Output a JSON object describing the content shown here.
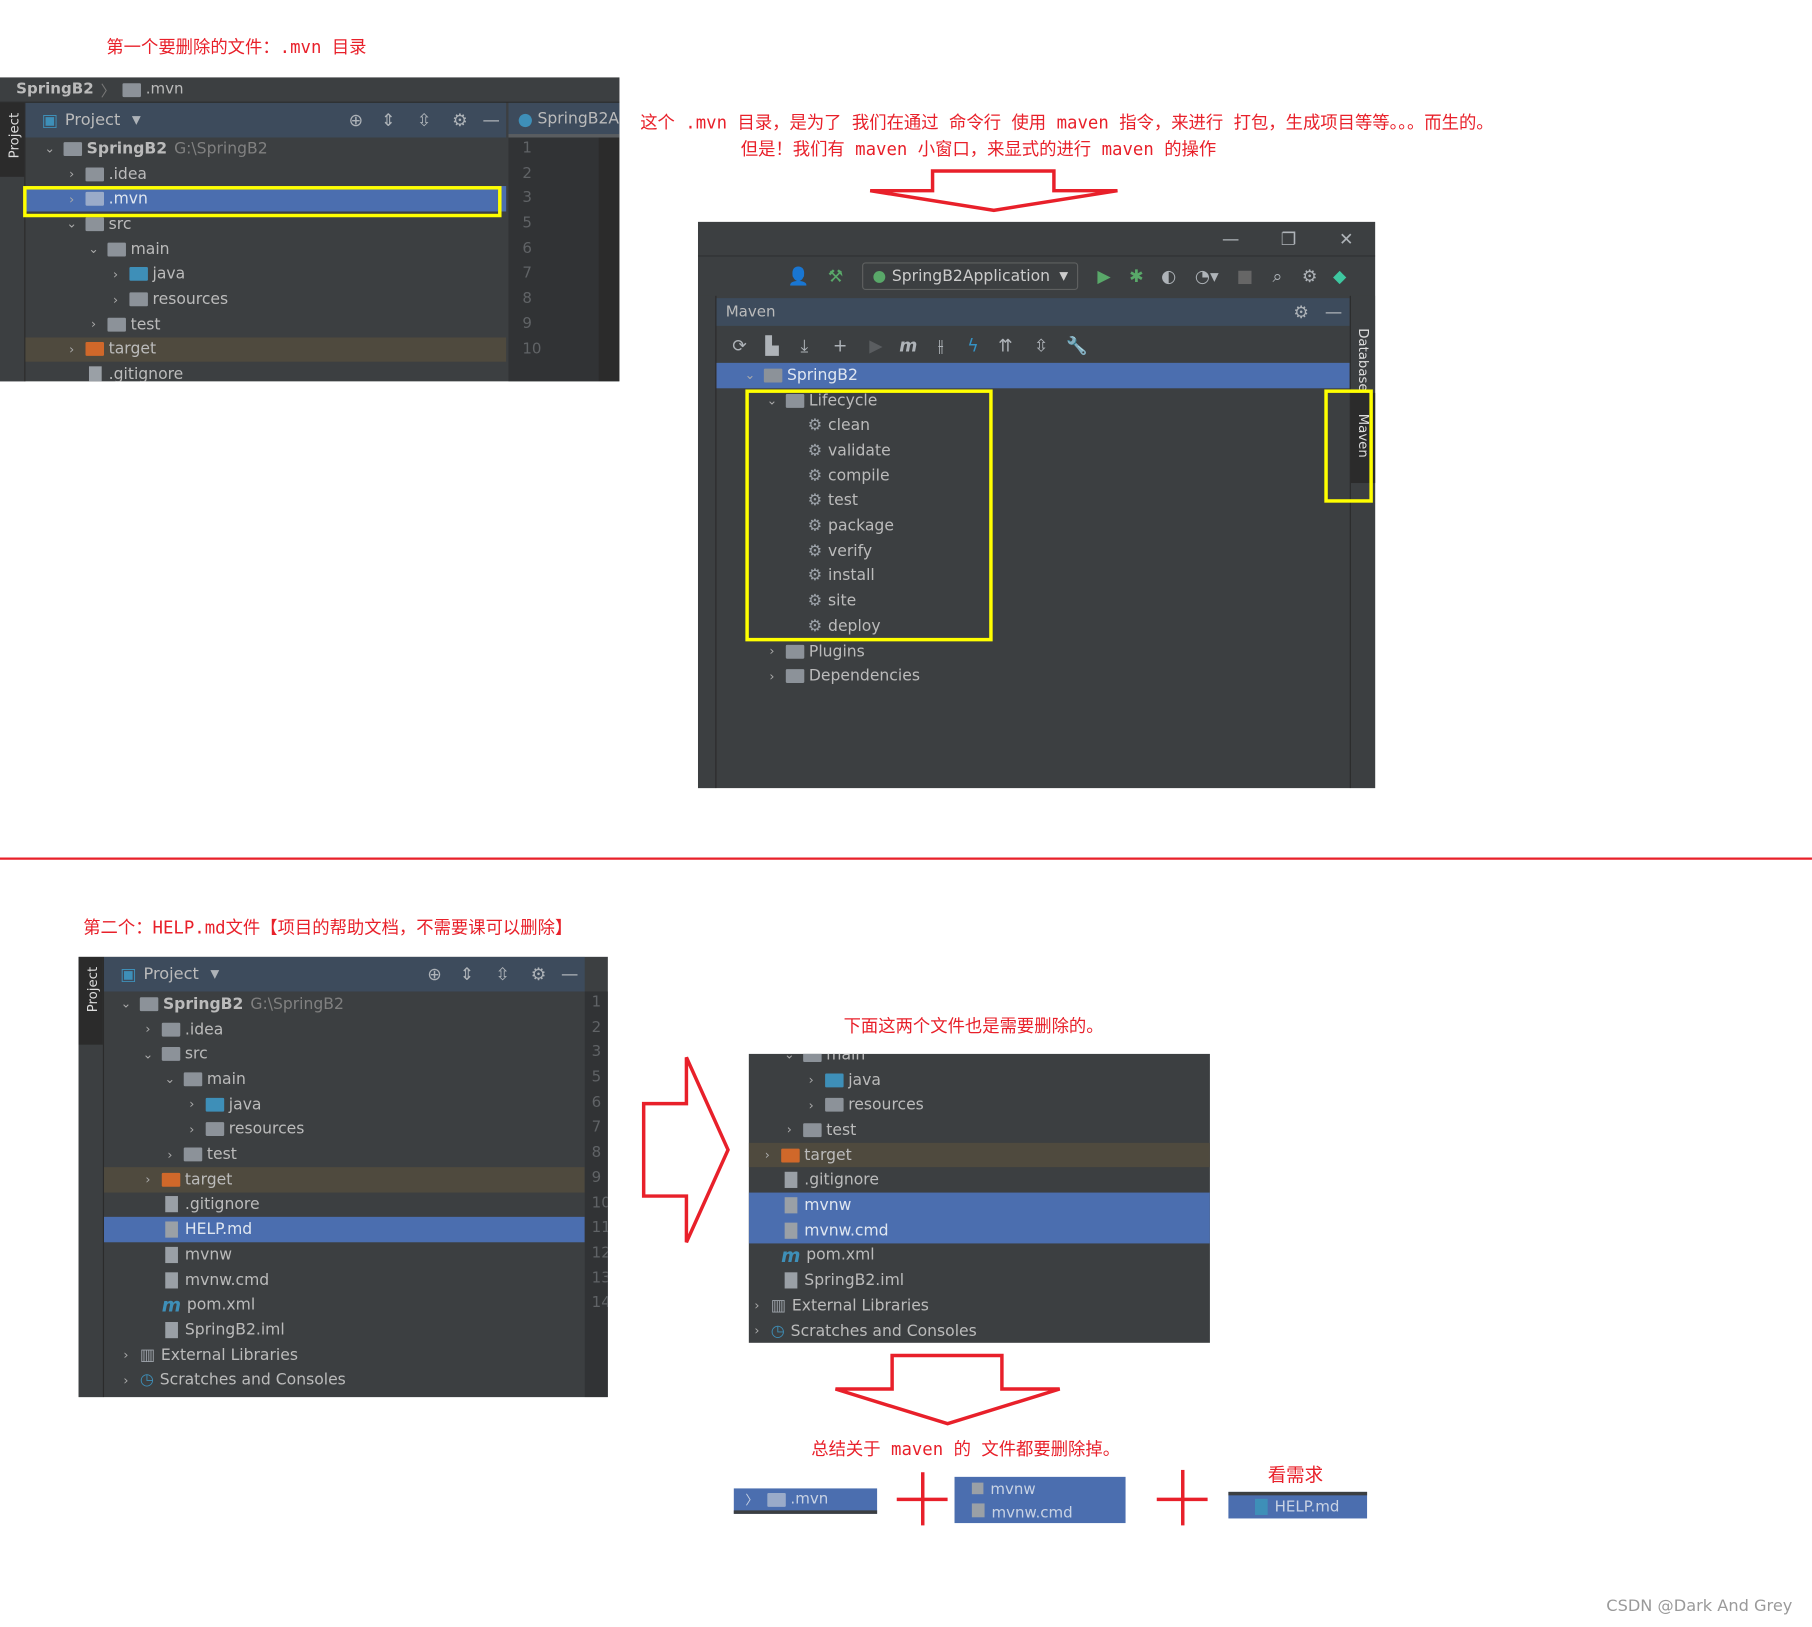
{
  "notes": {
    "first": "第一个要删除的文件：.mvn 目录",
    "explain_line1": "这个 .mvn 目录，是为了 我们在通过 命令行 使用 maven 指令，来进行 打包，生成项目等等。。。而生的。",
    "explain_line2": "但是！我们有 maven 小窗口，来显式的进行 maven 的操作",
    "second": "第二个：HELP.md文件【项目的帮助文档，不需要课可以删除】",
    "also_delete": "下面这两个文件也是需要删除的。",
    "summary": "总结关于 maven 的 文件都要删除掉。",
    "as_needed": "看需求",
    "watermark": "CSDN @Dark And Grey"
  },
  "colors": {
    "annotation": "#e8202a",
    "highlight_box": "#ffff00",
    "selection": "#4b6eaf",
    "ide_bg": "#3c3f41"
  },
  "panel_a": {
    "breadcrumb": [
      "SpringB2",
      ".mvn"
    ],
    "side_tab": "Project",
    "header": "Project",
    "editor_tab": "SpringB2A",
    "line_numbers": [
      "1",
      "2",
      "3",
      "5",
      "6",
      "7",
      "8",
      "9",
      "10"
    ],
    "tree": [
      {
        "label": "SpringB2",
        "extra": "G:\\SpringB2",
        "depth": 0,
        "chev": "v",
        "icon": "module",
        "bold": true
      },
      {
        "label": ".idea",
        "depth": 1,
        "chev": ">",
        "icon": "folder"
      },
      {
        "label": ".mvn",
        "depth": 1,
        "chev": ">",
        "icon": "folder",
        "sel": true
      },
      {
        "label": "src",
        "depth": 1,
        "chev": "v",
        "icon": "folder"
      },
      {
        "label": "main",
        "depth": 2,
        "chev": "v",
        "icon": "folder"
      },
      {
        "label": "java",
        "depth": 3,
        "chev": ">",
        "icon": "folder-blue"
      },
      {
        "label": "resources",
        "depth": 3,
        "chev": ">",
        "icon": "folder"
      },
      {
        "label": "test",
        "depth": 2,
        "chev": ">",
        "icon": "folder"
      },
      {
        "label": "target",
        "depth": 1,
        "chev": ">",
        "icon": "folder-orange",
        "hl": true
      },
      {
        "label": ".gitignore",
        "depth": 1,
        "chev": "",
        "icon": "file"
      }
    ]
  },
  "maven_window": {
    "run_config": "SpringB2Application",
    "panel_title": "Maven",
    "side_tabs": [
      "Database",
      "Maven"
    ],
    "tree": [
      {
        "label": "SpringB2",
        "depth": 0,
        "chev": "v",
        "icon": "module",
        "sel": true
      },
      {
        "label": "Lifecycle",
        "depth": 1,
        "chev": "v",
        "icon": "folder"
      },
      {
        "label": "clean",
        "depth": 2,
        "chev": "",
        "icon": "gear"
      },
      {
        "label": "validate",
        "depth": 2,
        "chev": "",
        "icon": "gear"
      },
      {
        "label": "compile",
        "depth": 2,
        "chev": "",
        "icon": "gear"
      },
      {
        "label": "test",
        "depth": 2,
        "chev": "",
        "icon": "gear"
      },
      {
        "label": "package",
        "depth": 2,
        "chev": "",
        "icon": "gear"
      },
      {
        "label": "verify",
        "depth": 2,
        "chev": "",
        "icon": "gear"
      },
      {
        "label": "install",
        "depth": 2,
        "chev": "",
        "icon": "gear"
      },
      {
        "label": "site",
        "depth": 2,
        "chev": "",
        "icon": "gear"
      },
      {
        "label": "deploy",
        "depth": 2,
        "chev": "",
        "icon": "gear"
      },
      {
        "label": "Plugins",
        "depth": 1,
        "chev": ">",
        "icon": "folder"
      },
      {
        "label": "Dependencies",
        "depth": 1,
        "chev": ">",
        "icon": "folder"
      }
    ]
  },
  "panel_b": {
    "side_tab": "Project",
    "header": "Project",
    "line_numbers": [
      "1",
      "2",
      "3",
      "5",
      "6",
      "7",
      "8",
      "9",
      "10",
      "11",
      "12",
      "13",
      "14"
    ],
    "tree": [
      {
        "label": "SpringB2",
        "extra": "G:\\SpringB2",
        "depth": 0,
        "chev": "v",
        "icon": "module",
        "bold": true
      },
      {
        "label": ".idea",
        "depth": 1,
        "chev": ">",
        "icon": "folder"
      },
      {
        "label": "src",
        "depth": 1,
        "chev": "v",
        "icon": "folder"
      },
      {
        "label": "main",
        "depth": 2,
        "chev": "v",
        "icon": "folder"
      },
      {
        "label": "java",
        "depth": 3,
        "chev": ">",
        "icon": "folder-blue"
      },
      {
        "label": "resources",
        "depth": 3,
        "chev": ">",
        "icon": "folder"
      },
      {
        "label": "test",
        "depth": 2,
        "chev": ">",
        "icon": "folder"
      },
      {
        "label": "target",
        "depth": 1,
        "chev": ">",
        "icon": "folder-orange",
        "hl": true
      },
      {
        "label": ".gitignore",
        "depth": 1,
        "chev": "",
        "icon": "file"
      },
      {
        "label": "HELP.md",
        "depth": 1,
        "chev": "",
        "icon": "file",
        "sel": true
      },
      {
        "label": "mvnw",
        "depth": 1,
        "chev": "",
        "icon": "file"
      },
      {
        "label": "mvnw.cmd",
        "depth": 1,
        "chev": "",
        "icon": "file"
      },
      {
        "label": "pom.xml",
        "depth": 1,
        "chev": "",
        "icon": "maven"
      },
      {
        "label": "SpringB2.iml",
        "depth": 1,
        "chev": "",
        "icon": "file"
      },
      {
        "label": "External Libraries",
        "depth": 0,
        "chev": ">",
        "icon": "libs"
      },
      {
        "label": "Scratches and Consoles",
        "depth": 0,
        "chev": ">",
        "icon": "scratch"
      }
    ]
  },
  "panel_c": {
    "tree": [
      {
        "label": "main",
        "depth": 2,
        "chev": "v",
        "icon": "folder"
      },
      {
        "label": "java",
        "depth": 3,
        "chev": ">",
        "icon": "folder-blue"
      },
      {
        "label": "resources",
        "depth": 3,
        "chev": ">",
        "icon": "folder"
      },
      {
        "label": "test",
        "depth": 2,
        "chev": ">",
        "icon": "folder"
      },
      {
        "label": "target",
        "depth": 1,
        "chev": ">",
        "icon": "folder-orange",
        "hl": true
      },
      {
        "label": ".gitignore",
        "depth": 1,
        "chev": "",
        "icon": "file"
      },
      {
        "label": "mvnw",
        "depth": 1,
        "chev": "",
        "icon": "file",
        "sel": true
      },
      {
        "label": "mvnw.cmd",
        "depth": 1,
        "chev": "",
        "icon": "file",
        "sel": true
      },
      {
        "label": "pom.xml",
        "depth": 1,
        "chev": "",
        "icon": "maven"
      },
      {
        "label": "SpringB2.iml",
        "depth": 1,
        "chev": "",
        "icon": "file"
      },
      {
        "label": "External Libraries",
        "depth": 0,
        "chev": ">",
        "icon": "libs"
      },
      {
        "label": "Scratches and Consoles",
        "depth": 0,
        "chev": ">",
        "icon": "scratch"
      }
    ]
  },
  "summary_items": {
    "mvn": ".mvn",
    "mvnw": "mvnw",
    "mvnw_cmd": "mvnw.cmd",
    "help": "HELP.md"
  }
}
